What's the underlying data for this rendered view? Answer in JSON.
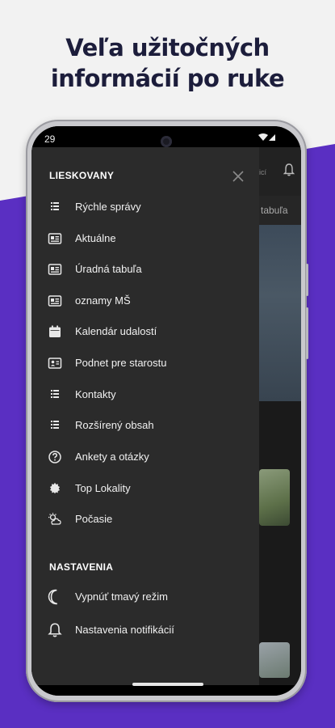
{
  "headline": {
    "line1": "Veľa užitočných",
    "line2": "informácií po ruke"
  },
  "colors": {
    "accent": "#5a2fc2",
    "headline": "#1c1d3b",
    "drawer": "#2b2b2b"
  },
  "status_bar": {
    "time": "29",
    "icons": "▾◢"
  },
  "background_app": {
    "header_text": "icí",
    "tab_text": "tabuľa"
  },
  "drawer": {
    "close_icon": "close-icon",
    "section1_title": "LIESKOVANY",
    "items": [
      {
        "label": "Rýchle správy",
        "icon": "list-icon"
      },
      {
        "label": "Aktuálne",
        "icon": "newspaper-icon"
      },
      {
        "label": "Úradná tabuľa",
        "icon": "newspaper-icon"
      },
      {
        "label": "oznamy MŠ",
        "icon": "newspaper-icon"
      },
      {
        "label": "Kalendár udalostí",
        "icon": "calendar-icon"
      },
      {
        "label": "Podnet pre starostu",
        "icon": "contact-card-icon"
      },
      {
        "label": "Kontakty",
        "icon": "list-icon"
      },
      {
        "label": "Rozšírený obsah",
        "icon": "list-icon"
      },
      {
        "label": "Ankety a otázky",
        "icon": "question-circle-icon"
      },
      {
        "label": "Top Lokality",
        "icon": "badge-icon"
      },
      {
        "label": "Počasie",
        "icon": "weather-icon"
      }
    ],
    "section2_title": "NASTAVENIA",
    "settings": [
      {
        "label": "Vypnúť tmavý režim",
        "icon": "moon-icon"
      },
      {
        "label": "Nastavenia notifikácií",
        "icon": "bell-icon"
      }
    ]
  }
}
